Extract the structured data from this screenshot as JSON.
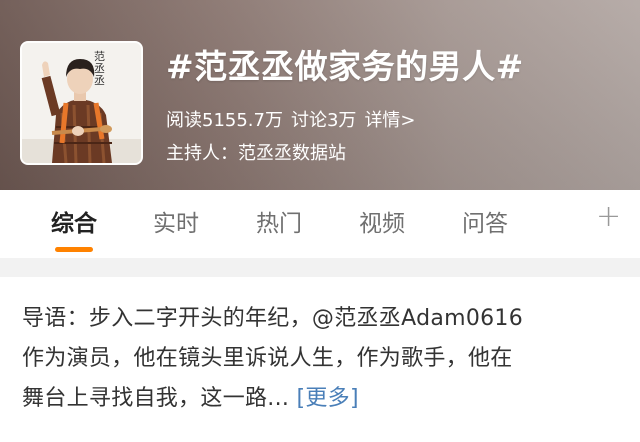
{
  "topic": {
    "title": "#范丞丞做家务的男人#",
    "cover_label": "范丞丞",
    "reads": "阅读5155.7万",
    "discussions": "讨论3万",
    "details_link": "详情>",
    "host": "主持人：范丞丞数据站"
  },
  "tabs": [
    {
      "label": "综合",
      "active": true
    },
    {
      "label": "实时"
    },
    {
      "label": "热门"
    },
    {
      "label": "视频"
    },
    {
      "label": "问答"
    }
  ],
  "add_tab_icon": "plus-icon",
  "intro": {
    "line1": "导语：步入二字开头的年纪，@范丞丞Adam0616",
    "line2": "作为演员，他在镜头里诉说人生，作为歌手，他在",
    "line3": "舞台上寻找自我，这一路...",
    "more": "[更多]"
  },
  "colors": {
    "accent": "#ff8200",
    "link": "#4a7fb8"
  }
}
